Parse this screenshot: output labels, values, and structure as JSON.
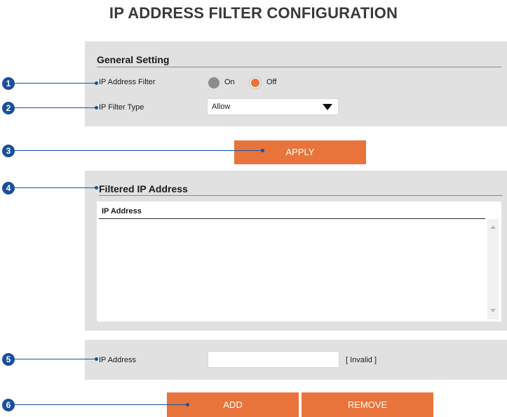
{
  "page_title": "IP ADDRESS FILTER CONFIGURATION",
  "general": {
    "section_title": "General Setting",
    "filter_label": "IP Address Filter",
    "on_label": "On",
    "off_label": "Off",
    "selected": "Off",
    "type_label": "IP Filter Type",
    "type_value": "Allow"
  },
  "apply_label": "APPLY",
  "filtered": {
    "section_title": "Filtered IP Address",
    "column_header": "IP Address",
    "rows": []
  },
  "ip_entry": {
    "label": "IP Address",
    "value": "",
    "status": "[ Invalid ]"
  },
  "add_label": "ADD",
  "remove_label": "REMOVE",
  "callouts": [
    "1",
    "2",
    "3",
    "4",
    "5",
    "6"
  ],
  "colors": {
    "accent": "#e8743b",
    "panel": "#e1e1e1",
    "callout": "#1a4f9c"
  }
}
